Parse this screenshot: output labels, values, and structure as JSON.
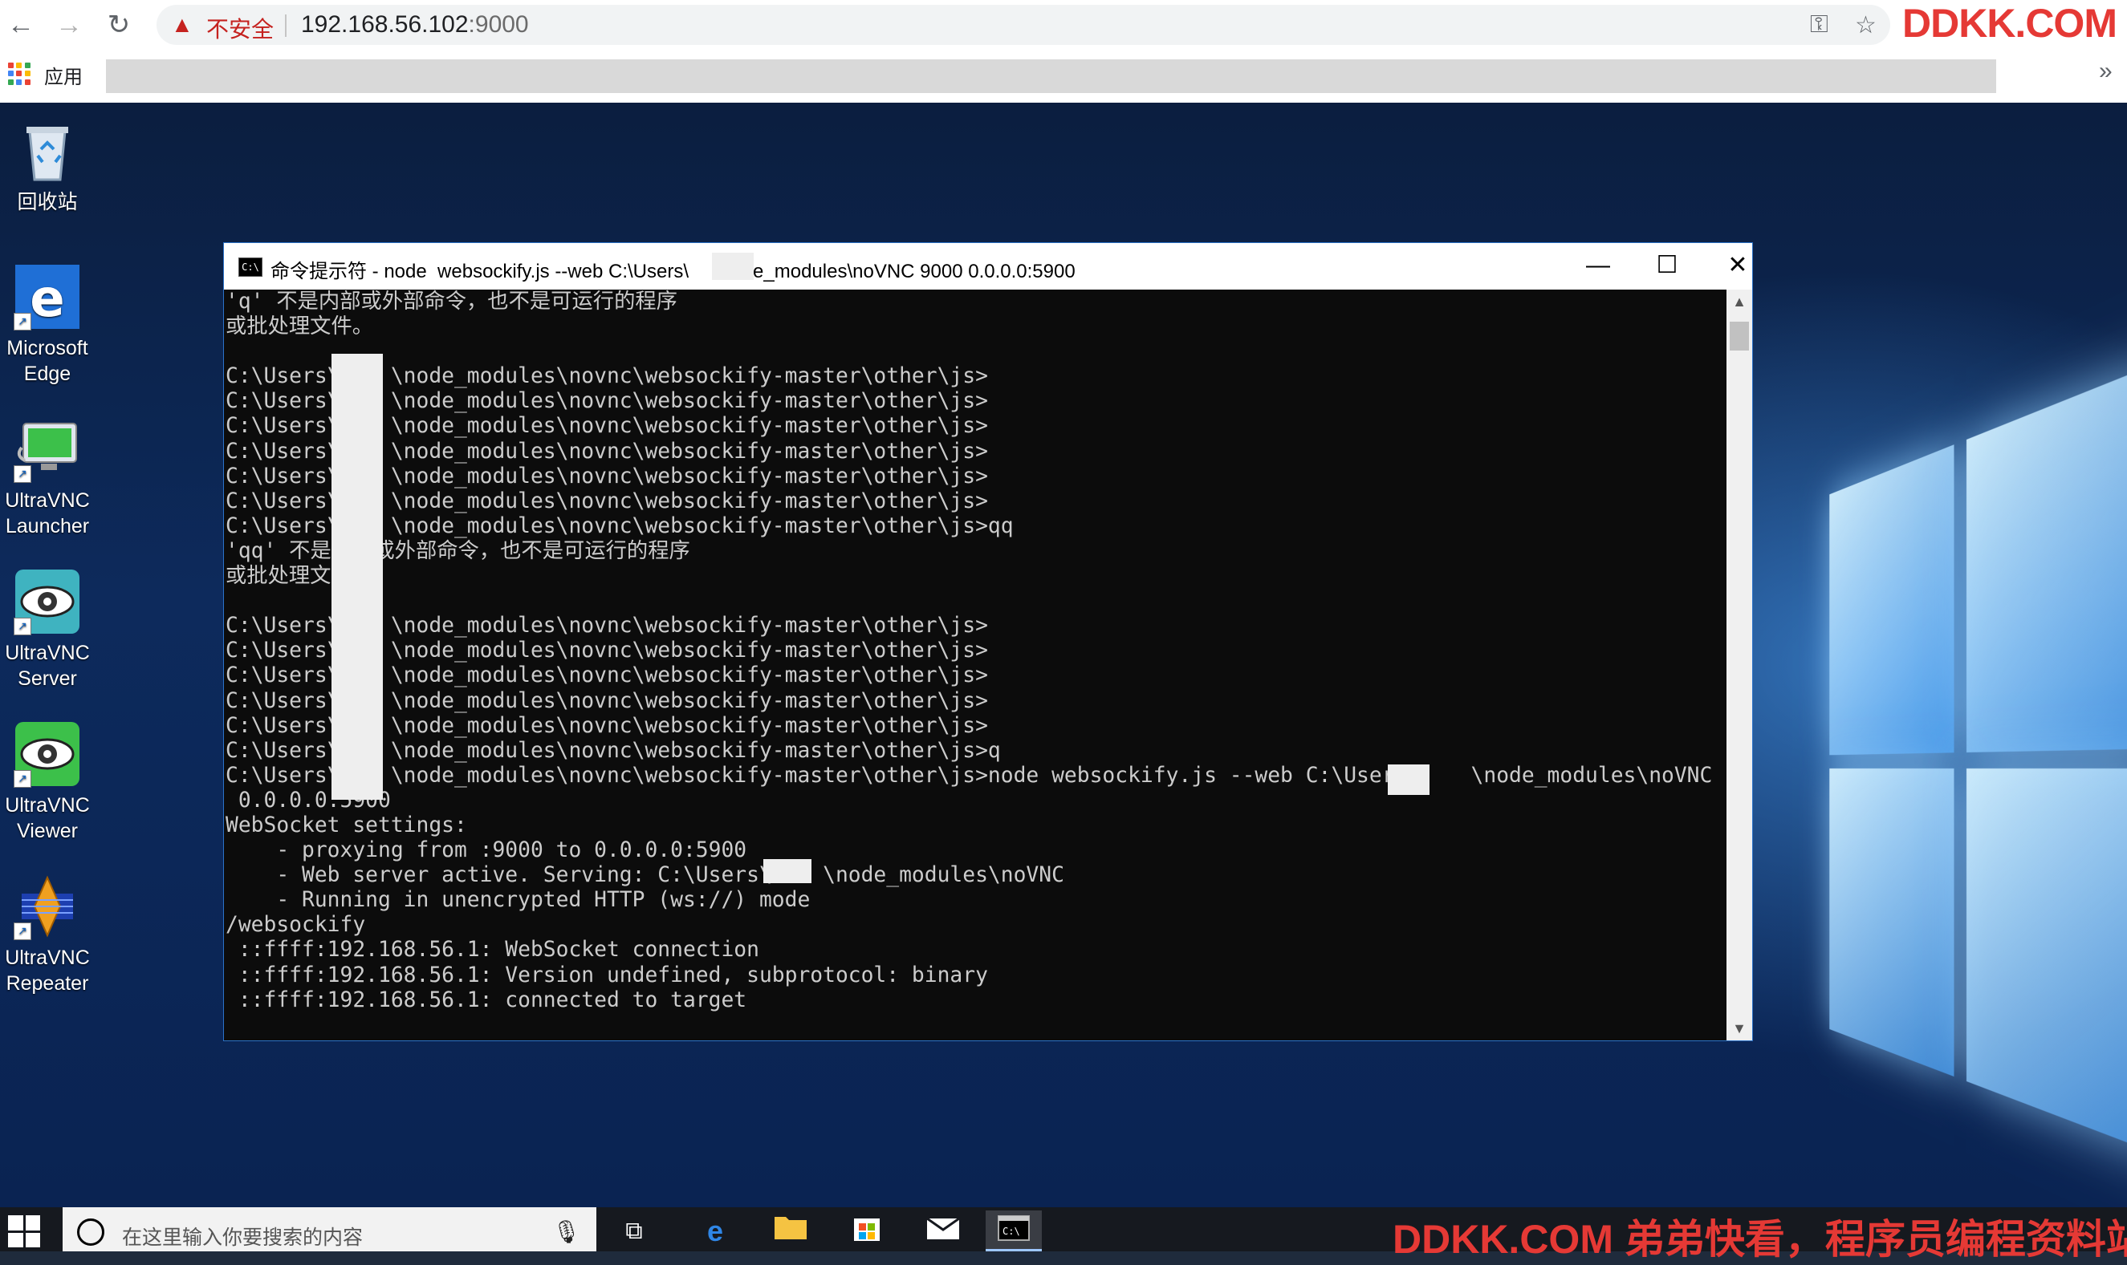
{
  "browser": {
    "insecure_label": "不安全",
    "url_host": "192.168.56.102",
    "url_port": ":9000",
    "brand": "DDKK.COM",
    "apps_label": "应用",
    "overflow": "»",
    "icons": [
      "back-icon",
      "forward-icon",
      "reload-icon",
      "warning-icon",
      "key-icon",
      "star-icon"
    ]
  },
  "desktop": {
    "icons": [
      {
        "label_line1": "回收站",
        "label_line2": ""
      },
      {
        "label_line1": "Microsoft",
        "label_line2": "Edge"
      },
      {
        "label_line1": "UltraVNC",
        "label_line2": "Launcher"
      },
      {
        "label_line1": "UltraVNC",
        "label_line2": "Server"
      },
      {
        "label_line1": "UltraVNC",
        "label_line2": "Viewer"
      },
      {
        "label_line1": "UltraVNC",
        "label_line2": "Repeater"
      }
    ]
  },
  "cmd_window": {
    "icon_text": "C:\\",
    "title": "命令提示符 - node  websockify.js --web C:\\Users\\      node_modules\\noVNC 9000 0.0.0.0:5900",
    "minimize": "—",
    "maximize": "☐",
    "close": "✕",
    "console_text": "'q' 不是内部或外部命令，也不是可运行的程序\n或批处理文件。\n\nC:\\Users\\    \\node_modules\\novnc\\websockify-master\\other\\js>\nC:\\Users\\    \\node_modules\\novnc\\websockify-master\\other\\js>\nC:\\Users\\    \\node_modules\\novnc\\websockify-master\\other\\js>\nC:\\Users\\    \\node_modules\\novnc\\websockify-master\\other\\js>\nC:\\Users\\    \\node_modules\\novnc\\websockify-master\\other\\js>\nC:\\Users\\    \\node_modules\\novnc\\websockify-master\\other\\js>\nC:\\Users\\    \\node_modules\\novnc\\websockify-master\\other\\js>qq\n'qq' 不是内部或外部命令，也不是可运行的程序\n或批处理文件。\n\nC:\\Users\\    \\node_modules\\novnc\\websockify-master\\other\\js>\nC:\\Users\\    \\node_modules\\novnc\\websockify-master\\other\\js>\nC:\\Users\\    \\node_modules\\novnc\\websockify-master\\other\\js>\nC:\\Users\\    \\node_modules\\novnc\\websockify-master\\other\\js>\nC:\\Users\\    \\node_modules\\novnc\\websockify-master\\other\\js>\nC:\\Users\\    \\node_modules\\novnc\\websockify-master\\other\\js>q\nC:\\Users\\    \\node_modules\\novnc\\websockify-master\\other\\js>node websockify.js --web C:\\Users\\    \\node_modules\\noVNC 9000\n 0.0.0.0:5900\nWebSocket settings:\n    - proxying from :9000 to 0.0.0.0:5900\n    - Web server active. Serving: C:\\Users\\    \\node_modules\\noVNC\n    - Running in unencrypted HTTP (ws://) mode\n/websockify\n ::ffff:192.168.56.1: WebSocket connection\n ::ffff:192.168.56.1: Version undefined, subprotocol: binary\n ::ffff:192.168.56.1: connected to target"
  },
  "taskbar": {
    "search_placeholder": "在这里输入你要搜索的内容",
    "watermark": "DDKK.COM 弟弟快看，程序员编程资料站",
    "icons": [
      "windows-start-icon",
      "search-icon",
      "microphone-icon",
      "task-view-icon",
      "edge-icon",
      "file-explorer-icon",
      "store-icon",
      "mail-icon",
      "cmd-icon"
    ]
  },
  "colors": {
    "accent_red": "#e53935",
    "console_bg": "#0c0c0c",
    "console_fg": "#cccccc",
    "window_border": "#2b72c8"
  }
}
